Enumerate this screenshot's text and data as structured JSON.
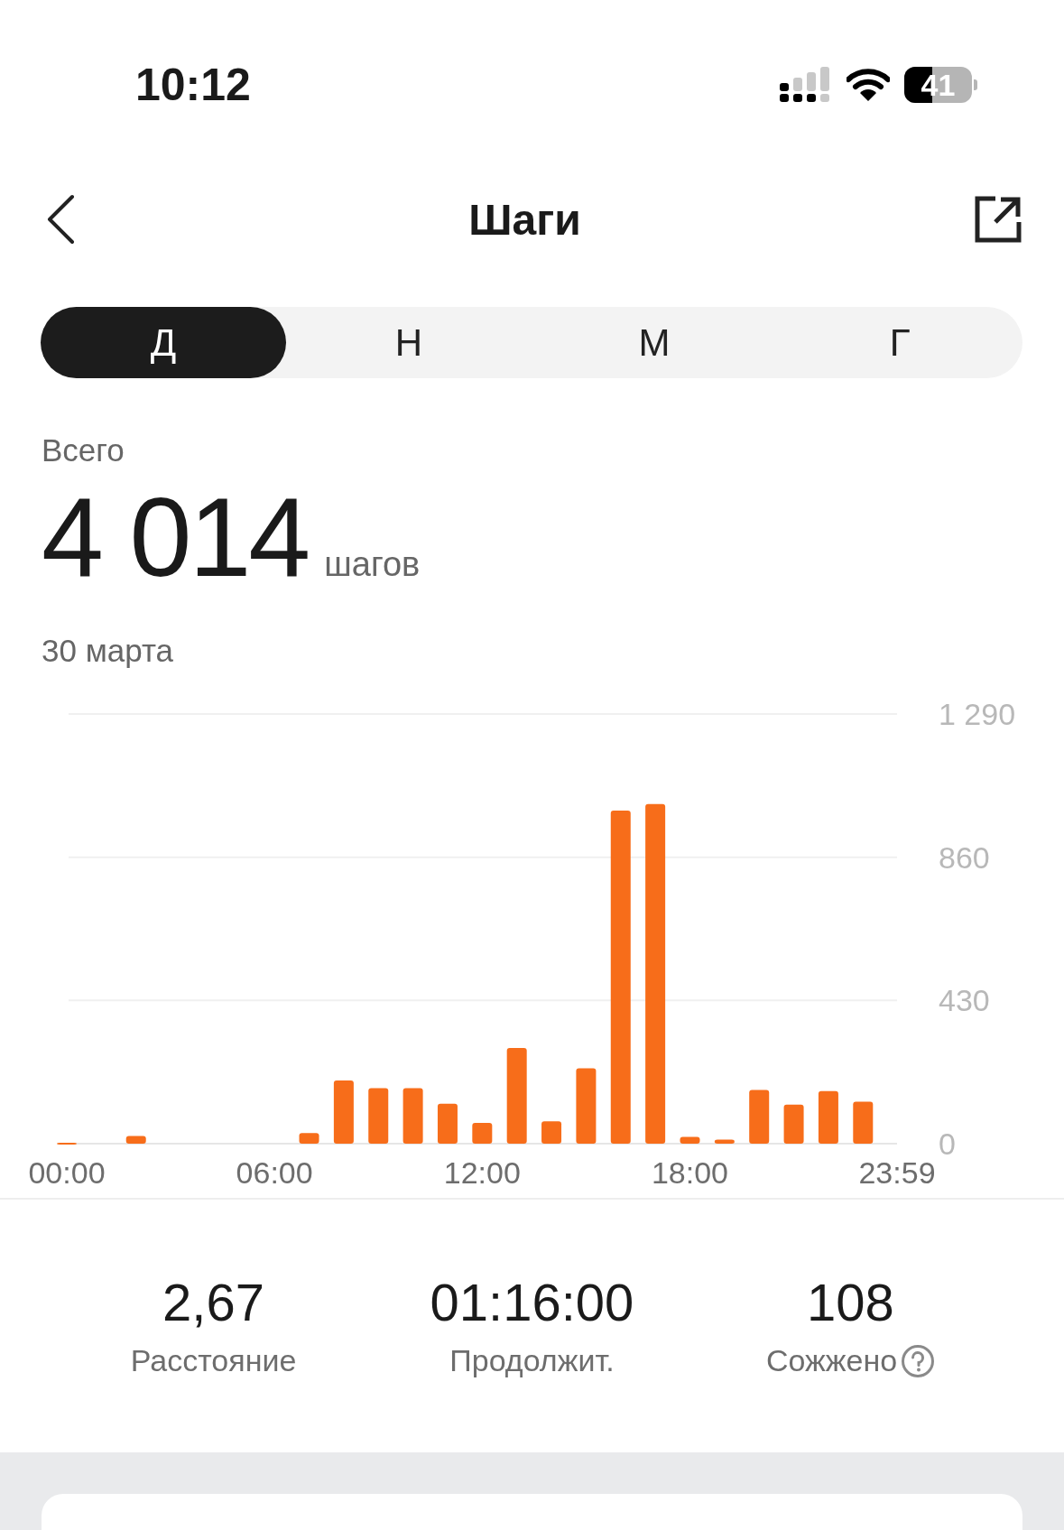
{
  "status_bar": {
    "time": "10:12",
    "battery": "41"
  },
  "nav": {
    "title": "Шаги"
  },
  "tabs": [
    {
      "label": "Д",
      "selected": true
    },
    {
      "label": "Н",
      "selected": false
    },
    {
      "label": "М",
      "selected": false
    },
    {
      "label": "Г",
      "selected": false
    }
  ],
  "summary": {
    "label": "Всего",
    "value": "4 014",
    "unit": "шагов",
    "date": "30 марта"
  },
  "chart_data": {
    "type": "bar",
    "x": [
      0,
      1,
      2,
      3,
      4,
      5,
      6,
      7,
      8,
      9,
      10,
      11,
      12,
      13,
      14,
      15,
      16,
      17,
      18,
      19,
      20,
      21,
      22,
      23
    ],
    "series": [
      {
        "color": "#f76d1a",
        "values": [
          3,
          0,
          23,
          0,
          0,
          0,
          0,
          32,
          190,
          167,
          167,
          120,
          62,
          287,
          67,
          226,
          1000,
          1020,
          20,
          12,
          161,
          117,
          158,
          126
        ]
      }
    ],
    "xlim": [
      0,
      23.983
    ],
    "ylim": [
      0,
      1290
    ],
    "yticks": [
      0,
      430,
      860,
      {
        "value": 1290,
        "label": "1 290"
      }
    ],
    "xticks": [
      {
        "value": 0,
        "label": "00:00"
      },
      {
        "value": 6,
        "label": "06:00"
      },
      {
        "value": 12,
        "label": "12:00"
      },
      {
        "value": 18,
        "label": "18:00"
      },
      {
        "value": 23.983,
        "label": "23:59"
      }
    ]
  },
  "stats": [
    {
      "value": "2,67",
      "label": "Расстояние",
      "help": false
    },
    {
      "value": "01:16:00",
      "label": "Продолжит.",
      "help": false
    },
    {
      "value": "108",
      "label": "Сожжено",
      "help": true
    }
  ]
}
